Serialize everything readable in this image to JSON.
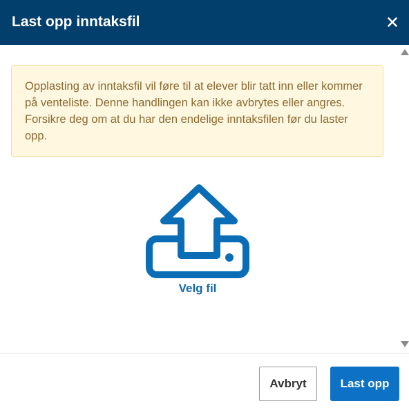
{
  "dialog": {
    "title": "Last opp inntaksfil",
    "close_icon": "close-icon"
  },
  "warning": {
    "text": "Opplasting av inntaksfil vil føre til at elever blir tatt inn eller kommer på venteliste. Denne handlingen kan ikke avbrytes eller angres. Forsikre deg om at du har den endelige inntaksfilen før du laster opp."
  },
  "upload": {
    "icon": "upload-icon",
    "choose_file_label": "Velg fil"
  },
  "footer": {
    "cancel_label": "Avbryt",
    "upload_label": "Last opp"
  },
  "colors": {
    "header_bg": "#033f6c",
    "accent": "#0d72c5",
    "warning_bg": "#fff7e0",
    "warning_text": "#8a6a31",
    "icon_blue": "#0a6db5"
  }
}
